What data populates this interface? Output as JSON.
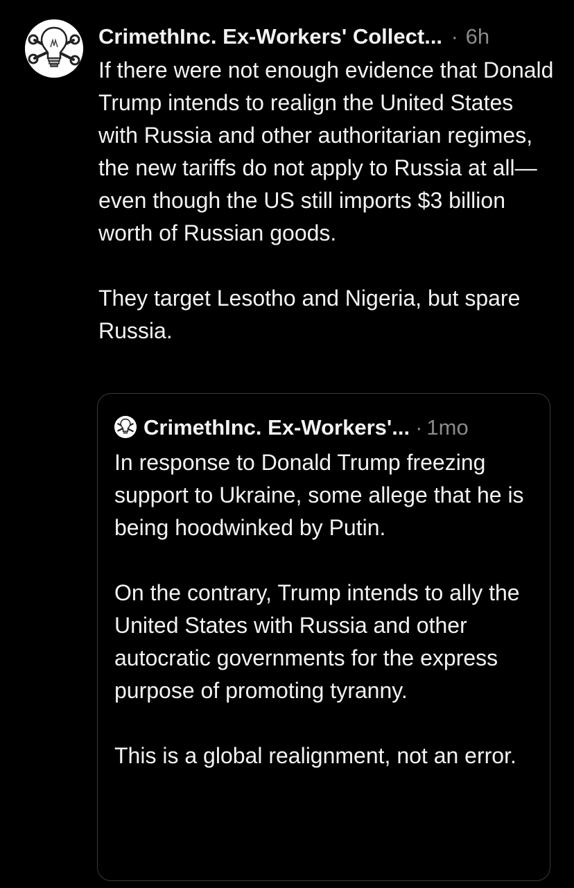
{
  "post": {
    "author": "CrimethInc. Ex-Workers' Collect...",
    "separator": "·",
    "time": "6h",
    "avatar_icon": "lightbulb-wrench-skull-icon",
    "paragraphs": [
      "If there were not enough evidence that Donald Trump intends to realign the United States with Russia and other authoritarian regimes, the new tariffs do not apply to Russia at all—even though the US still imports $3 billion worth of Russian goods.",
      "They target Lesotho and Nigeria, but spare Russia."
    ]
  },
  "quoted_post": {
    "author": "CrimethInc. Ex-Workers'...",
    "separator": "·",
    "time": "1mo",
    "avatar_icon": "lightbulb-wrench-skull-icon",
    "paragraphs": [
      "In response to Donald Trump freezing support to Ukraine, some allege that he is being hoodwinked by Putin.",
      "On the contrary, Trump intends to ally the United States with Russia and other autocratic governments for the express purpose of promoting tyranny.",
      "This is a global realignment, not an error."
    ]
  },
  "colors": {
    "background": "#000000",
    "text": "#f3f3f3",
    "muted": "#8a8a8a",
    "border": "#3a3a3a"
  }
}
